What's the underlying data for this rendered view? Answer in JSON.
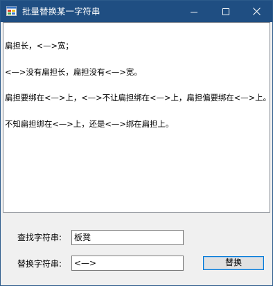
{
  "window": {
    "title": "批量替换某一字符串",
    "titlebar_color": "#1f4e82",
    "icons": {
      "app": "app-form-icon",
      "minimize": "minimize-icon",
      "maximize": "maximize-icon",
      "close": "close-icon"
    }
  },
  "editor": {
    "lines": [
      "扁担长，<—>宽；",
      "<—>没有扁担长，扁担没有<—>宽。",
      "扁担要绑在<—>上，<—>不让扁担绑在<—>上，扁担偏要绑在<—>上。",
      "不知扁担绑在<—>上，还是<—>绑在扁担上。"
    ]
  },
  "form": {
    "find_label": "查找字符串:",
    "find_value": "板凳",
    "replace_label": "替换字符串:",
    "replace_value": "<—>",
    "replace_button": "替换"
  }
}
